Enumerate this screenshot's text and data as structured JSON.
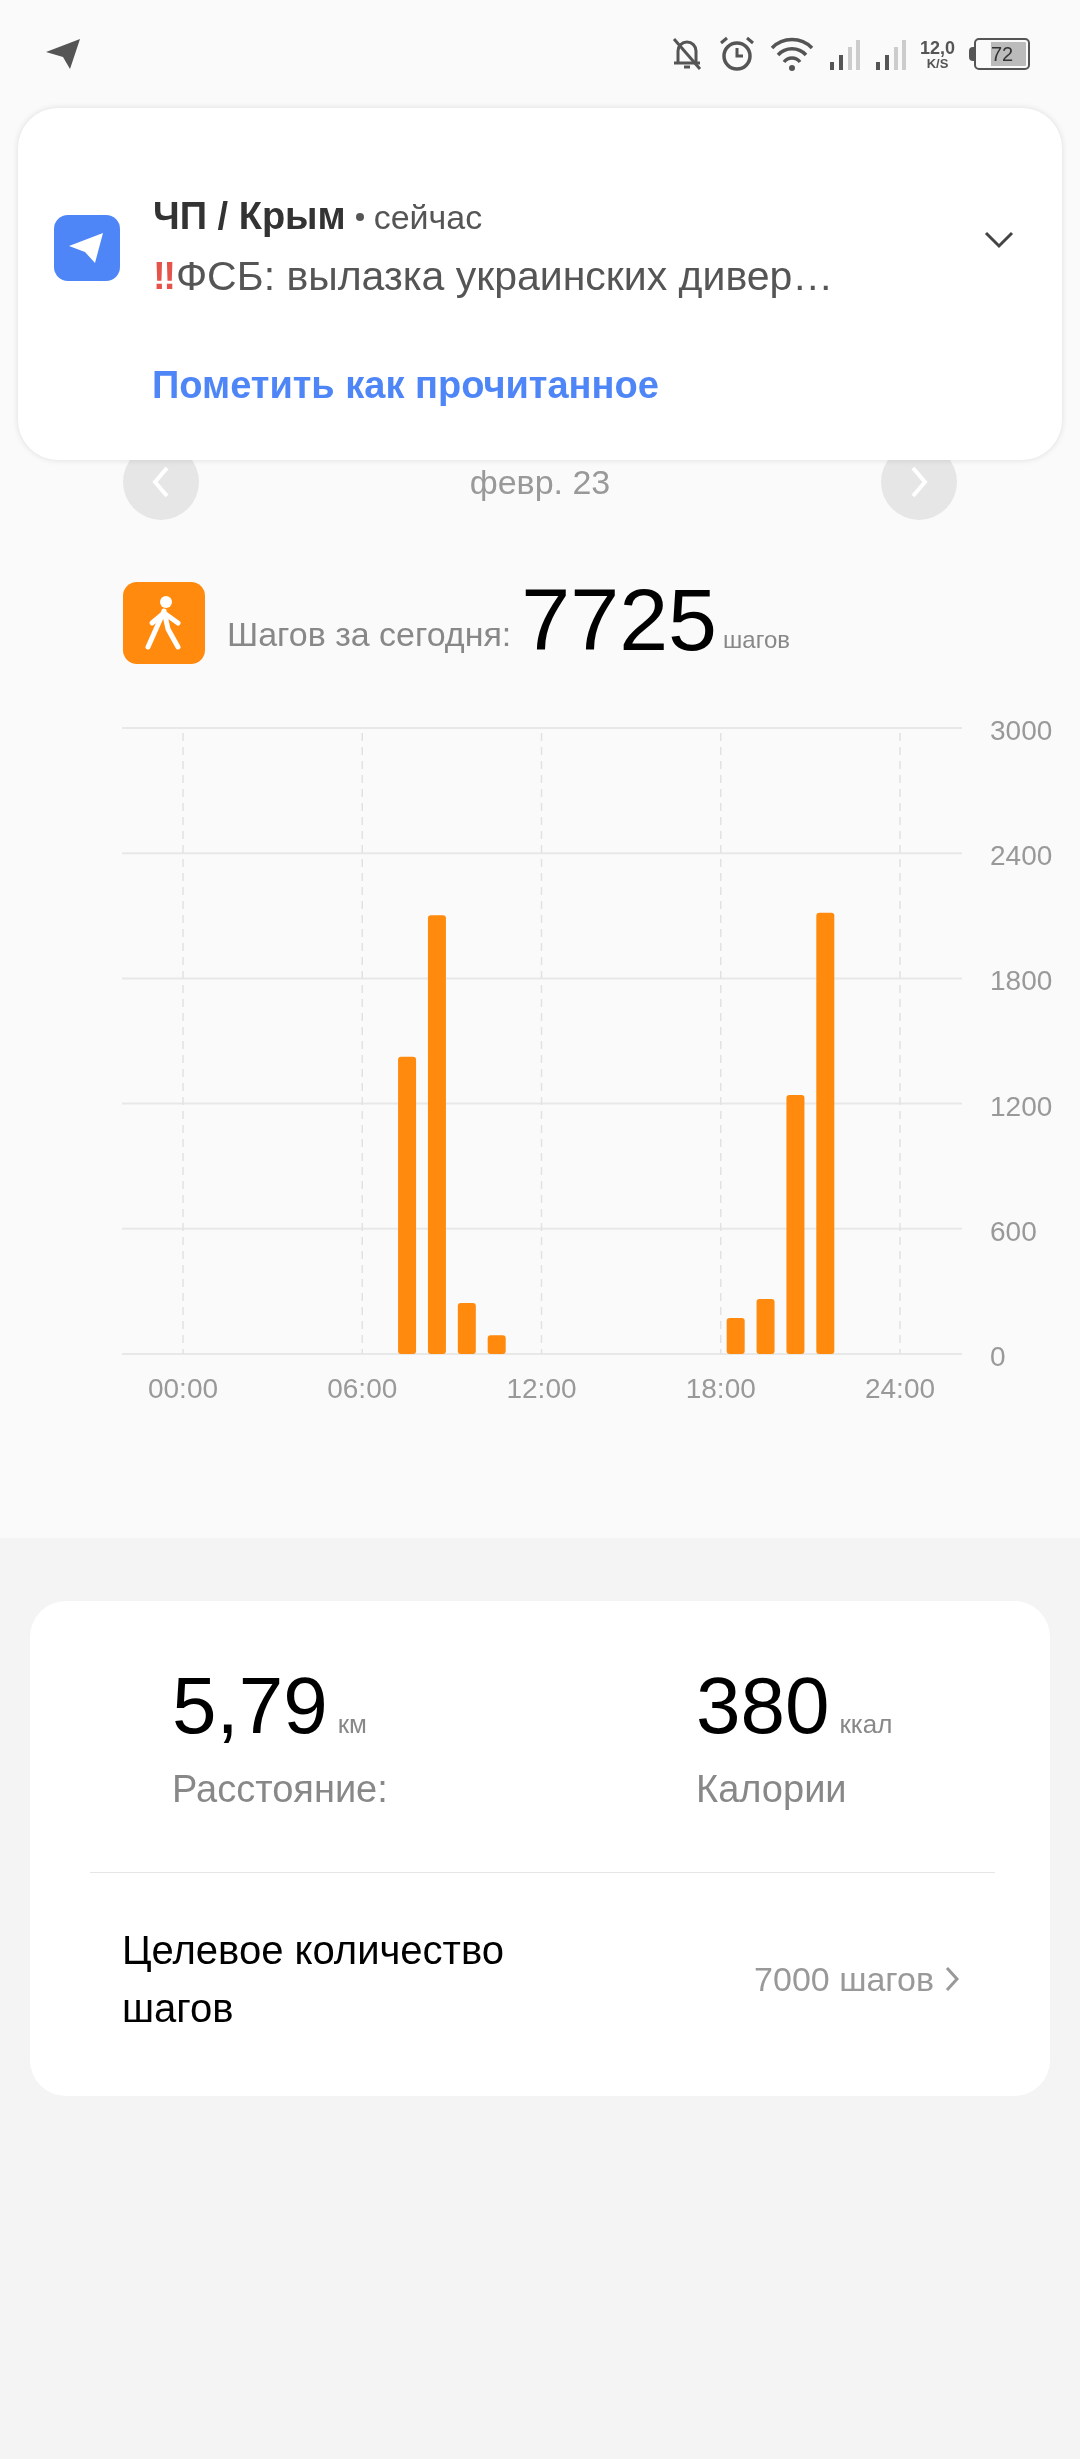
{
  "status_bar": {
    "network_speed": "12,0",
    "speed_unit": "K/S",
    "battery": "72"
  },
  "notification": {
    "app": "ЧП / Крым",
    "time": "сейчас",
    "alert_glyph": "‼",
    "message": "ФСБ: вылазка украинских дивер…",
    "action": "Пометить как прочитанное"
  },
  "date": "февр. 23",
  "steps": {
    "label": "Шагов за сегодня:",
    "value": "7725",
    "unit": "шагов"
  },
  "chart_data": {
    "type": "bar",
    "x": [
      7.5,
      8.5,
      9.5,
      10.5,
      18.5,
      19.5,
      20.5,
      21.5
    ],
    "grid": true,
    "series": [
      {
        "color": "#ff8a0d",
        "values": [
          1424,
          2103,
          245,
          90,
          173,
          263,
          1241,
          2115
        ]
      }
    ],
    "xlim": [
      0,
      24
    ],
    "ylim": [
      0,
      3000
    ],
    "xticks": [
      {
        "value": 0,
        "label": "00:00"
      },
      {
        "value": 6,
        "label": "06:00"
      },
      {
        "value": 12,
        "label": "12:00"
      },
      {
        "value": 18,
        "label": "18:00"
      },
      {
        "value": 24,
        "label": "24:00"
      }
    ],
    "yticks": [
      0,
      600,
      1200,
      1800,
      2400,
      3000
    ]
  },
  "summary": {
    "distance": {
      "value": "5,79",
      "unit": "км",
      "label": "Расстояние:"
    },
    "calories": {
      "value": "380",
      "unit": "ккал",
      "label": "Калории"
    },
    "goal": {
      "label": "Целевое количество шагов",
      "value": "7000 шагов"
    }
  }
}
